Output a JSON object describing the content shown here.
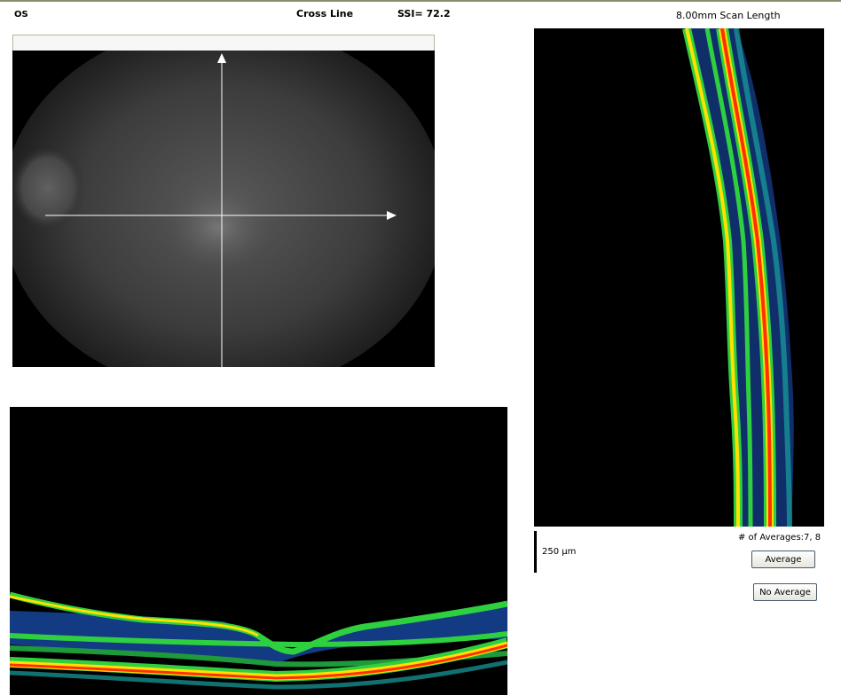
{
  "header": {
    "eye": "OS",
    "scan_type": "Cross Line",
    "ssi": "SSI= 72.2",
    "scan_length": "8.00mm Scan Length"
  },
  "scale": {
    "label": "250 µm"
  },
  "averages": {
    "label": "# of Averages:7, 8"
  },
  "buttons": {
    "average": "Average",
    "no_average": "No Average"
  },
  "colors": {
    "background": "#ffffff",
    "scan_background": "#000000",
    "layer_red": "#ff3000",
    "layer_yellow": "#ffe000",
    "layer_green": "#2fd040",
    "layer_blue": "#1860c0"
  }
}
